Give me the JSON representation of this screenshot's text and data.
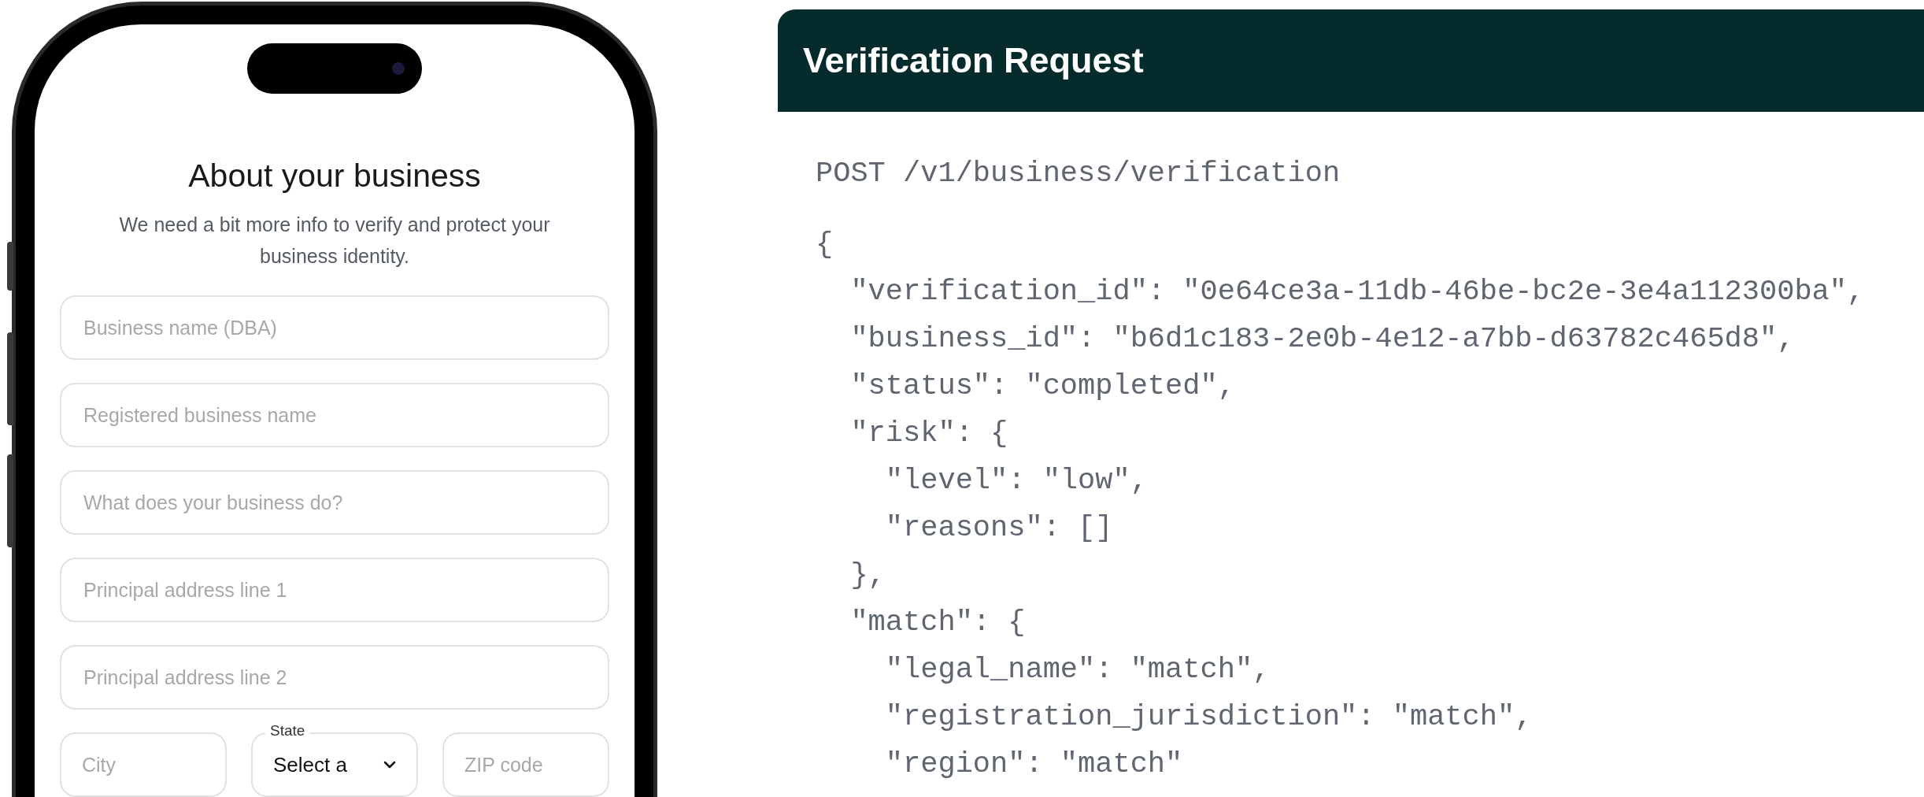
{
  "phone": {
    "title": "About your business",
    "subtitle": "We need a bit more info to verify and protect your business identity.",
    "fields": [
      {
        "placeholder": "Business name (DBA)"
      },
      {
        "placeholder": "Registered business name"
      },
      {
        "placeholder": "What does your business do?"
      },
      {
        "placeholder": "Principal address line 1"
      },
      {
        "placeholder": "Principal address line 2"
      }
    ],
    "row_fields": [
      {
        "kind": "input",
        "placeholder": "City"
      },
      {
        "kind": "select",
        "label": "State",
        "value": "Select a"
      },
      {
        "kind": "input",
        "placeholder": "ZIP code"
      }
    ]
  },
  "request_panel": {
    "title": "Verification Request",
    "request_line": "POST /v1/business/verification",
    "code_lines": [
      "{",
      "  \"verification_id\": \"0e64ce3a-11db-46be-bc2e-3e4a112300ba\",",
      "  \"business_id\": \"b6d1c183-2e0b-4e12-a7bb-d63782c465d8\",",
      "  \"status\": \"completed\",",
      "  \"risk\": {",
      "    \"level\": \"low\",",
      "    \"reasons\": []",
      "  },",
      "  \"match\": {",
      "    \"legal_name\": \"match\",",
      "    \"registration_jurisdiction\": \"match\",",
      "    \"region\": \"match\""
    ]
  }
}
